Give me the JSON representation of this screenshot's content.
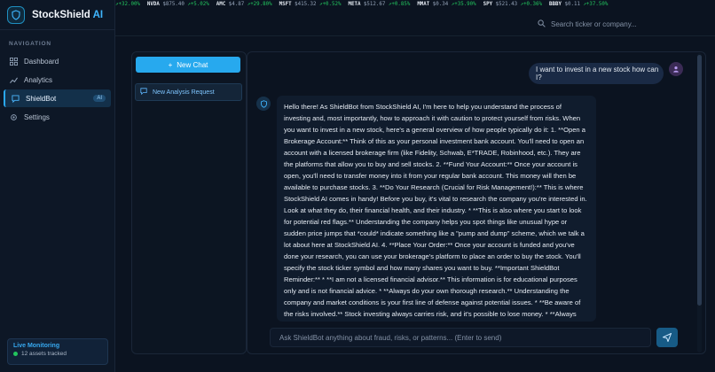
{
  "brand": {
    "name": "StockShield",
    "ai": " AI"
  },
  "ticker": [
    {
      "symbol": "",
      "price": "",
      "change": "↗+32.00%"
    },
    {
      "symbol": "NVDA",
      "price": "$875.40",
      "change": "↗+5.02%"
    },
    {
      "symbol": "AMC",
      "price": "$4.87",
      "change": "↗+29.80%"
    },
    {
      "symbol": "MSFT",
      "price": "$415.32",
      "change": "↗+0.52%"
    },
    {
      "symbol": "META",
      "price": "$512.67",
      "change": "↗+0.85%"
    },
    {
      "symbol": "MMAT",
      "price": "$0.34",
      "change": "↗+35.90%"
    },
    {
      "symbol": "SPY",
      "price": "$521.43",
      "change": "↗+0.36%"
    },
    {
      "symbol": "BBBY",
      "price": "$0.11",
      "change": "↗+37.50%"
    }
  ],
  "search": {
    "placeholder": "Search ticker or company..."
  },
  "nav": {
    "section_label": "NAVIGATION",
    "items": [
      {
        "label": "Dashboard",
        "icon": "grid-icon"
      },
      {
        "label": "Analytics",
        "icon": "chart-icon"
      },
      {
        "label": "ShieldBot",
        "icon": "chat-icon",
        "badge": "AI"
      },
      {
        "label": "Settings",
        "icon": "gear-icon"
      }
    ]
  },
  "live": {
    "title": "Live Monitoring",
    "subtitle": "12 assets tracked"
  },
  "chat_list": {
    "new_chat_label": "New Chat",
    "items": [
      {
        "label": "New Analysis Request"
      }
    ]
  },
  "messages": {
    "user": "I want to invest in a new stock how can I?",
    "bot": "Hello there! As ShieldBot from StockShield AI, I'm here to help you understand the process of investing and, most importantly, how to approach it with caution to protect yourself from risks. When you want to invest in a new stock, here's a general overview of how people typically do it: 1. **Open a Brokerage Account:** Think of this as your personal investment bank account. You'll need to open an account with a licensed brokerage firm (like Fidelity, Schwab, E*TRADE, Robinhood, etc.). They are the platforms that allow you to buy and sell stocks. 2. **Fund Your Account:** Once your account is open, you'll need to transfer money into it from your regular bank account. This money will then be available to purchase stocks. 3. **Do Your Research (Crucial for Risk Management!):** This is where StockShield AI comes in handy! Before you buy, it's vital to research the company you're interested in. Look at what they do, their financial health, and their industry. * **This is also where you start to look for potential red flags.** Understanding the company helps you spot things like unusual hype or sudden price jumps that *could* indicate something like a \"pump and dump\" scheme, which we talk a lot about here at StockShield AI. 4. **Place Your Order:** Once your account is funded and you've done your research, you can use your brokerage's platform to place an order to buy the stock. You'll specify the stock ticker symbol and how many shares you want to buy. **Important ShieldBot Reminder:** * **I am not a licensed financial advisor.** This information is for educational purposes only and is not financial advice. * **Always do your own thorough research.** Understanding the company and market conditions is your first line of defense against potential issues. * **Be aware of the risks involved.** Stock investing always carries risk, and it's possible to lose money. * **Always consult a licensed financial advisor** for personalized investment decisions tailored to your specific financial situation and goals. Let me know if you have any questions about specific risks or how to"
  },
  "composer": {
    "placeholder": "Ask ShieldBot anything about fraud, risks, or patterns... (Enter to send)"
  },
  "colors": {
    "accent": "#27a9ee",
    "positive": "#22c55e",
    "background": "#0b1320",
    "sidebar": "#0d1726"
  }
}
